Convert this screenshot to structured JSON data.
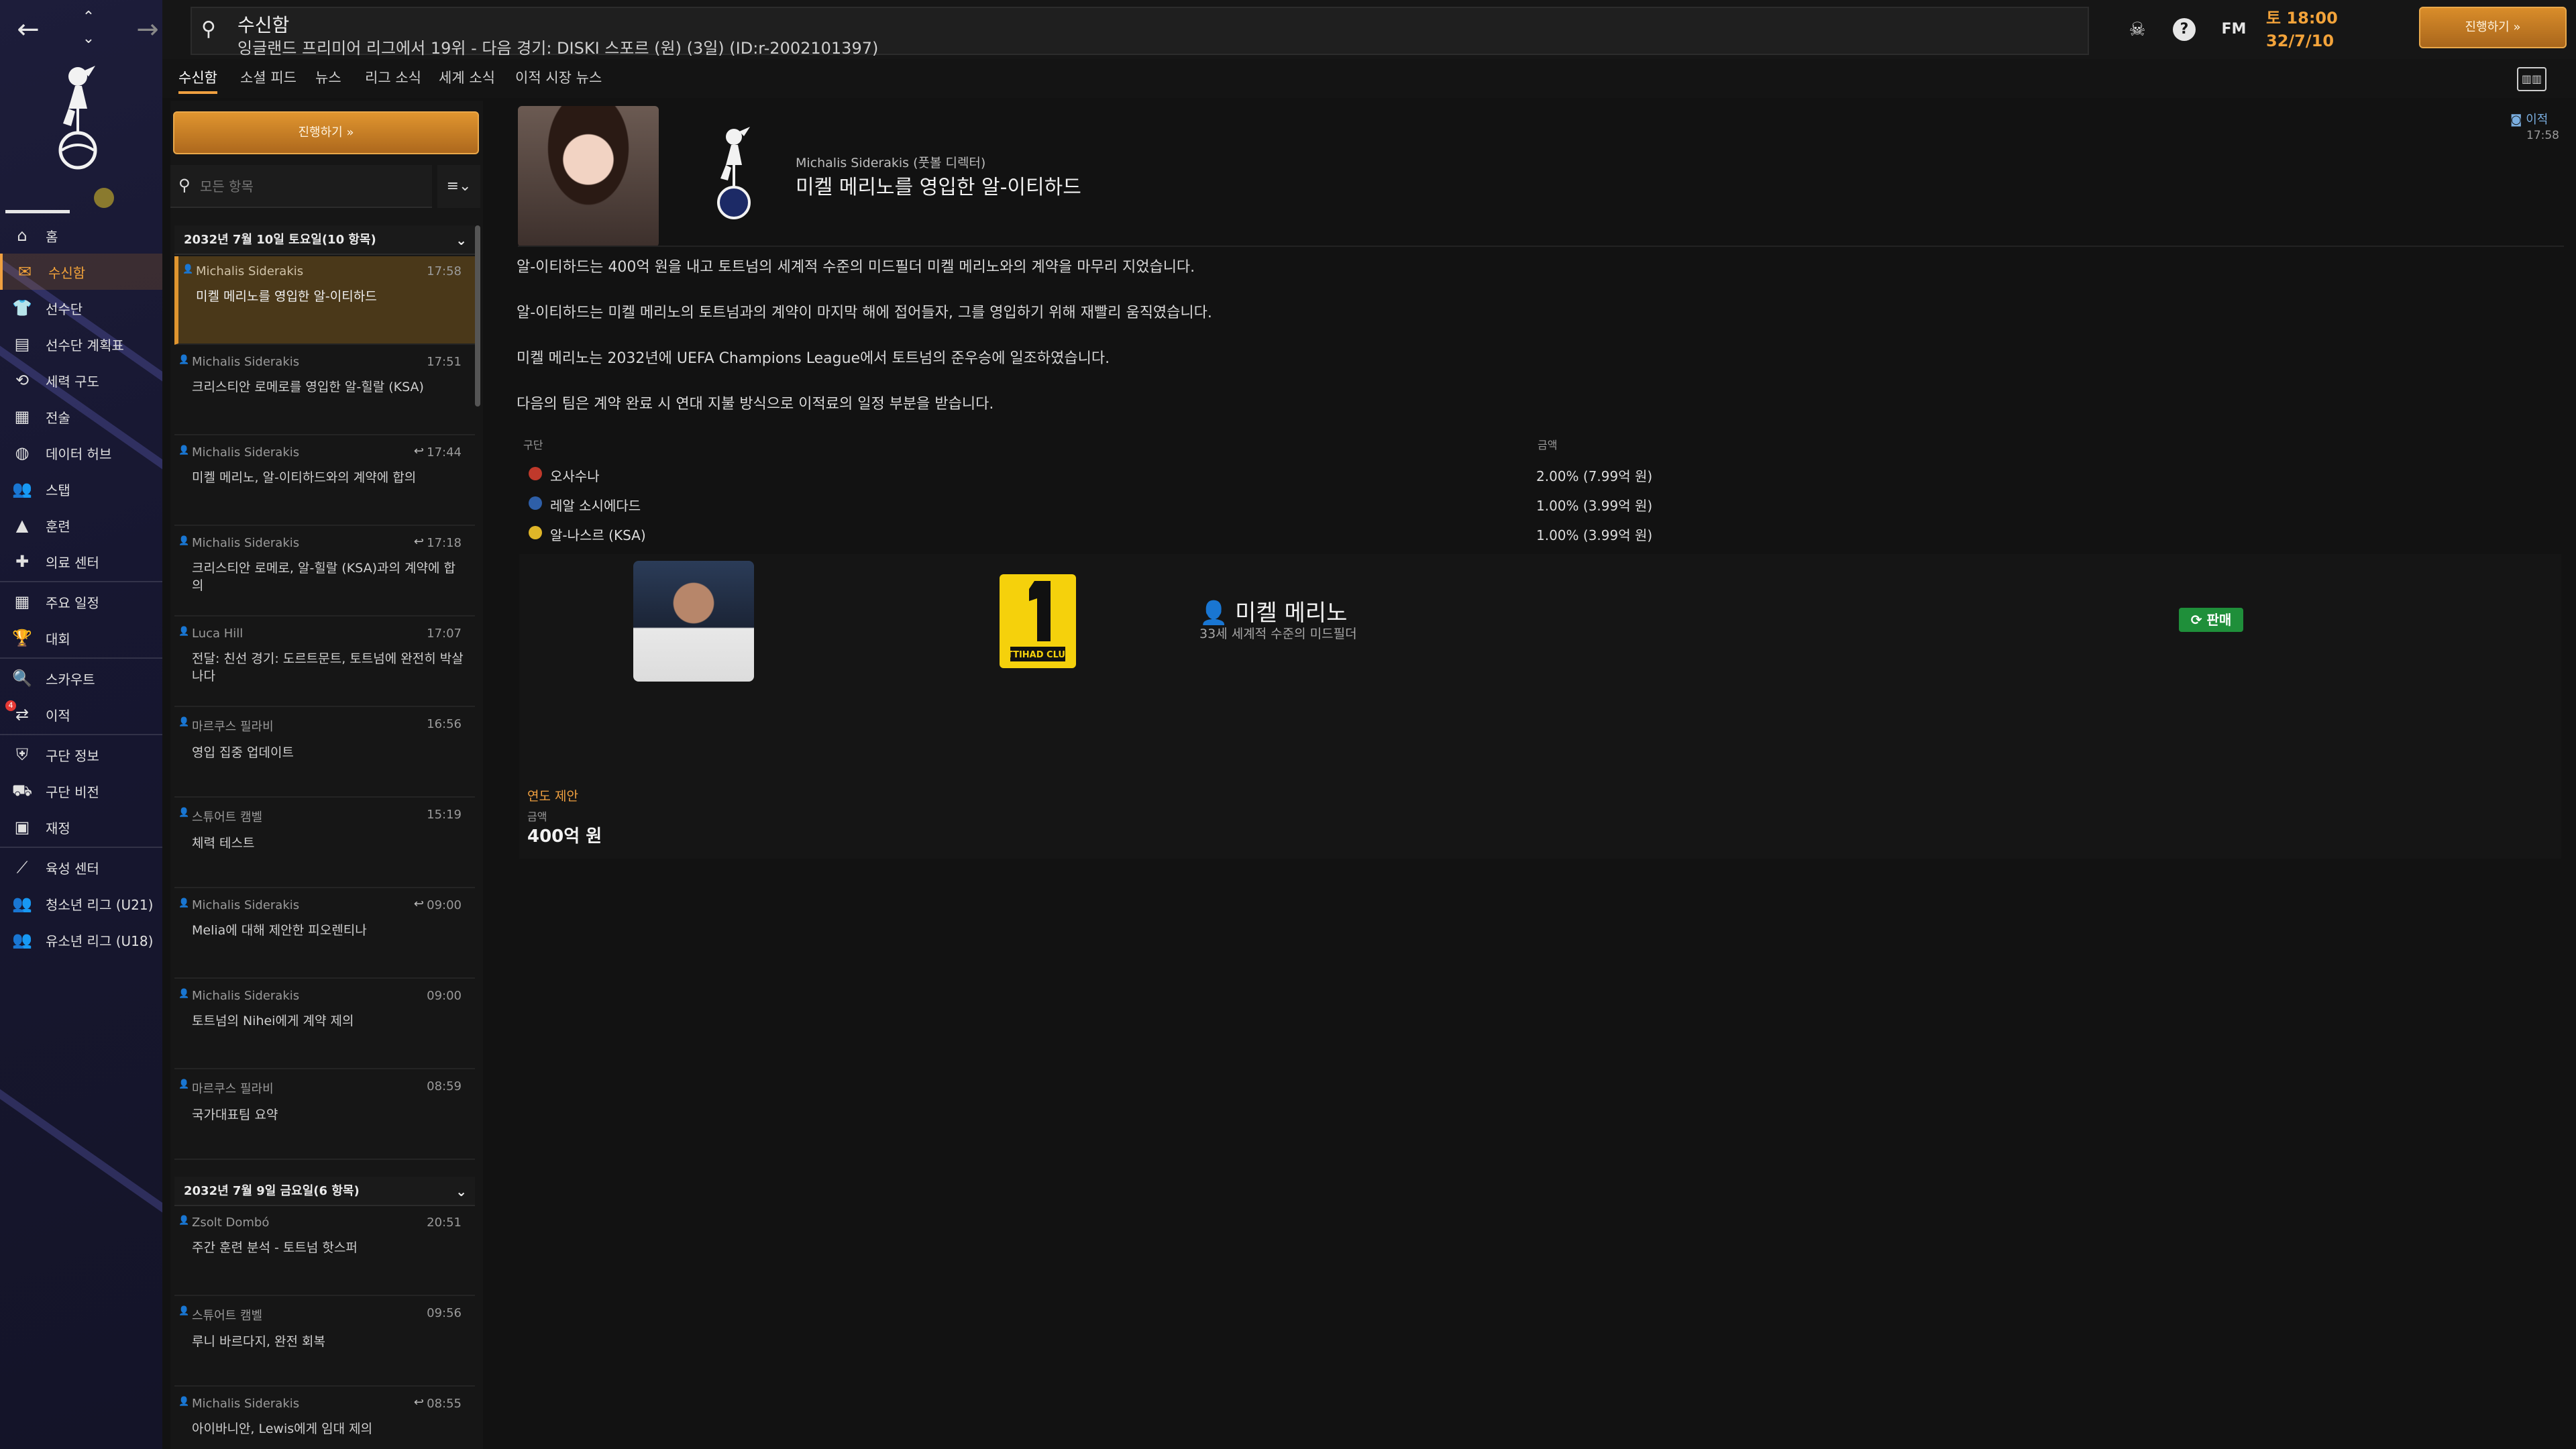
{
  "nav": {
    "back": "←",
    "forward": "→"
  },
  "sidebar": {
    "items": [
      {
        "label": "홈",
        "icon": "home-icon"
      },
      {
        "label": "수신함",
        "icon": "inbox-icon",
        "active": true
      },
      {
        "label": "선수단",
        "icon": "shirt-icon"
      },
      {
        "label": "선수단 계획표",
        "icon": "clipboard-icon"
      },
      {
        "label": "세력 구도",
        "icon": "hierarchy-icon"
      },
      {
        "label": "전술",
        "icon": "tactics-icon"
      },
      {
        "label": "데이터 허브",
        "icon": "data-icon"
      },
      {
        "label": "스탭",
        "icon": "staff-icon"
      },
      {
        "label": "훈련",
        "icon": "training-icon"
      },
      {
        "label": "의료 센터",
        "icon": "medical-icon"
      },
      {
        "label": "주요 일정",
        "icon": "calendar-icon"
      },
      {
        "label": "대회",
        "icon": "trophy-icon"
      },
      {
        "label": "스카우트",
        "icon": "scout-icon"
      },
      {
        "label": "이적",
        "icon": "transfer-icon",
        "badge": "4"
      },
      {
        "label": "구단 정보",
        "icon": "shield-icon"
      },
      {
        "label": "구단 비전",
        "icon": "vision-icon"
      },
      {
        "label": "재정",
        "icon": "finance-icon"
      },
      {
        "label": "육성 센터",
        "icon": "development-icon"
      },
      {
        "label": "청소년 리그 (U21)",
        "icon": "youth-icon"
      },
      {
        "label": "유소년 리그 (U18)",
        "icon": "youth-icon"
      }
    ]
  },
  "topbar": {
    "title": "수신함",
    "subtitle": "잉글랜드 프리미어 리그에서 19위 - 다음 경기: DISKI 스포르 (원) (3일) (ID:r-2002101397)",
    "fm_logo": "FM",
    "clock_time": "토 18:00",
    "clock_date": "32/7/10",
    "continue_label": "진행하기 »"
  },
  "tabs": [
    {
      "label": "수신함",
      "active": true
    },
    {
      "label": "소셜 피드"
    },
    {
      "label": "뉴스"
    },
    {
      "label": "리그 소식"
    },
    {
      "label": "세계 소식"
    },
    {
      "label": "이적 시장 뉴스"
    }
  ],
  "inbox": {
    "continue_label": "진행하기 »",
    "search_placeholder": "모든 항목",
    "groups": [
      {
        "header": "2032년 7월 10일 토요일(10 항목)",
        "messages": [
          {
            "sender": "Michalis Siderakis",
            "time": "17:58",
            "subject": "미켈 메리노를 영입한 알-이티하드",
            "selected": true
          },
          {
            "sender": "Michalis Siderakis",
            "time": "17:51",
            "subject": "크리스티안 로메로를 영입한 알-힐랄 (KSA)"
          },
          {
            "sender": "Michalis Siderakis",
            "time": "17:44",
            "subject": "미켈 메리노, 알-이티하드와의 계약에 합의",
            "reply": true
          },
          {
            "sender": "Michalis Siderakis",
            "time": "17:18",
            "subject": "크리스티안 로메로, 알-힐랄 (KSA)과의 계약에 합의",
            "reply": true
          },
          {
            "sender": "Luca Hill",
            "time": "17:07",
            "subject": "전달: 친선 경기: 도르트문트, 토트넘에 완전히 박살나다"
          },
          {
            "sender": "마르쿠스 필라비",
            "time": "16:56",
            "subject": "영입 집중 업데이트"
          },
          {
            "sender": "스튜어트 캠벨",
            "time": "15:19",
            "subject": "체력 테스트"
          },
          {
            "sender": "Michalis Siderakis",
            "time": "09:00",
            "subject": "Melia에 대해 제안한 피오렌티나",
            "reply": true
          },
          {
            "sender": "Michalis Siderakis",
            "time": "09:00",
            "subject": "토트넘의 Nihei에게 계약 제의"
          },
          {
            "sender": "마르쿠스 필라비",
            "time": "08:59",
            "subject": "국가대표팀 요약"
          }
        ]
      },
      {
        "header": "2032년 7월 9일 금요일(6 항목)",
        "messages": [
          {
            "sender": "Zsolt Dombó",
            "time": "20:51",
            "subject": "주간 훈련 분석 - 토트넘 핫스퍼"
          },
          {
            "sender": "스튜어트 캠벨",
            "time": "09:56",
            "subject": "루니 바르다지, 완전 회복"
          },
          {
            "sender": "Michalis Siderakis",
            "time": "08:55",
            "subject": "아이바니안, Lewis에게 임대 제의",
            "reply": true
          }
        ]
      }
    ]
  },
  "message": {
    "sender": "Michalis Siderakis (풋볼 디렉터)",
    "title": "미켈 메리노를 영입한 알-이티하드",
    "tag": "이적",
    "time": "17:58",
    "paragraphs": [
      "알-이티하드는 400억 원을 내고 토트넘의 세계적 수준의 미드필더 미켈 메리노와의 계약을 마무리 지었습니다.",
      "알-이티하드는 미켈 메리노의 토트넘과의 계약이 마지막 해에 접어들자, 그를 영입하기 위해 재빨리 움직였습니다.",
      "미켈 메리노는 2032년에 UEFA Champions League에서 토트넘의 준우승에 일조하였습니다.",
      "다음의 팀은 계약 완료 시 연대 지불 방식으로 이적료의 일정 부분을 받습니다."
    ],
    "clauses": {
      "col_club": "구단",
      "col_amount": "금액",
      "rows": [
        {
          "club": "오사수나",
          "amount": "2.00% (7.99억 원)",
          "color": "#c0392b"
        },
        {
          "club": "레알 소시에다드",
          "amount": "1.00% (3.99억 원)",
          "color": "#2e5fa8"
        },
        {
          "club": "알-나스르 (KSA)",
          "amount": "1.00% (3.99억 원)",
          "color": "#e0b628"
        }
      ]
    },
    "transfer": {
      "player_name": "미켈 메리노",
      "player_desc": "33세 세계적 수준의 미드필더",
      "status": "판매",
      "fee_type": "연도 제안",
      "fee_label": "금액",
      "fee_value": "400억 원",
      "club_badge_text": "ITTIHAD CLUB"
    }
  },
  "colors": {
    "accent": "#f0a040",
    "selected_bg": "#4a3819",
    "status_green": "#1f8f3a"
  }
}
